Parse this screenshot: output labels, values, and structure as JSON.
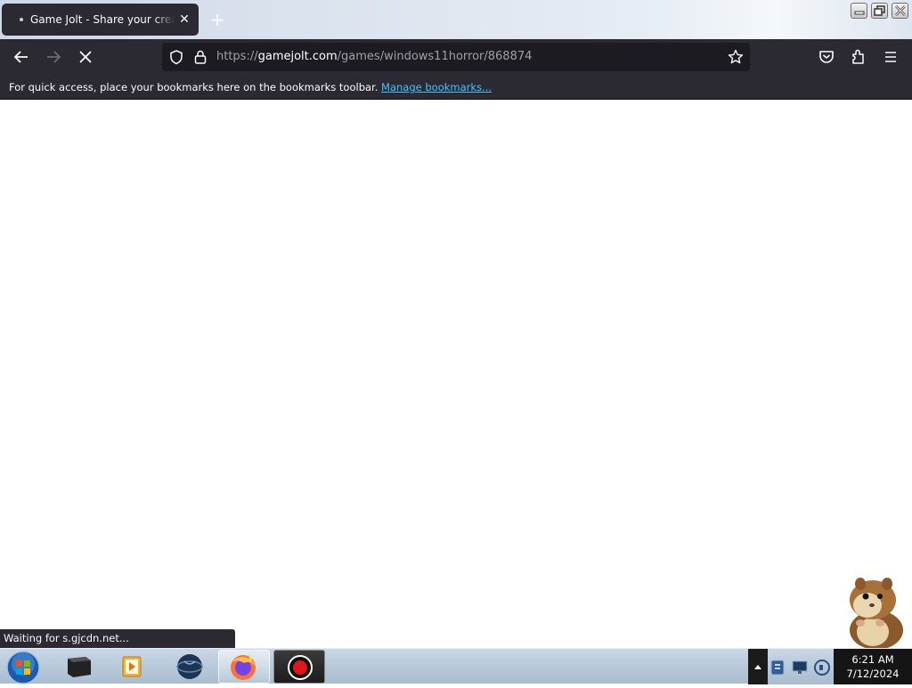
{
  "browser": {
    "tab": {
      "title": "Game Jolt - Share your creations",
      "close_icon": "close-icon"
    },
    "new_tab_icon": "plus-icon",
    "window_controls": [
      "minimize-icon",
      "restore-icon",
      "close-icon"
    ],
    "nav": {
      "back_icon": "arrow-left-icon",
      "forward_icon": "arrow-right-icon",
      "stop_icon": "stop-loading-icon",
      "url_prefix": "https://",
      "url_host": "gamejolt.com",
      "url_path": "/games/windows11horror/868874",
      "toolbar_icons": [
        "shield-icon",
        "lock-icon",
        "star-icon",
        "pocket-icon",
        "extensions-icon",
        "menu-icon"
      ]
    },
    "bookmarks": {
      "message": "For quick access, place your bookmarks here on the bookmarks toolbar.",
      "manage_link": "Manage bookmarks..."
    },
    "status": "Waiting for s.gjcdn.net..."
  },
  "taskbar": {
    "items": [
      "start-orb-icon",
      "terminal-icon",
      "media-player-icon",
      "app-globe-icon",
      "firefox-icon",
      "record-icon"
    ],
    "clock": {
      "time": "6:21 AM",
      "date": "7/12/2024"
    }
  },
  "colors": {
    "toolbar": "#2b2a33",
    "urlbar": "#1c1b22",
    "link": "#45c3ff",
    "taskbar": "#b9c9db"
  }
}
